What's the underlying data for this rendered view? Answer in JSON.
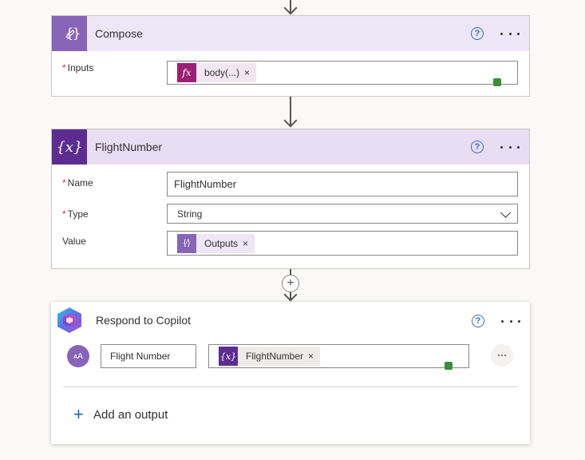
{
  "compose": {
    "title": "Compose",
    "inputs_label": "Inputs",
    "token_label": "body(...)",
    "token_icon": "fx-icon",
    "accent": "#8764b8"
  },
  "flight_number": {
    "title": "FlightNumber",
    "name_label": "Name",
    "name_value": "FlightNumber",
    "type_label": "Type",
    "type_value": "String",
    "value_label": "Value",
    "value_token": "Outputs",
    "accent": "#5c2d91"
  },
  "respond": {
    "title": "Respond to Copilot",
    "output_name": "Flight Number",
    "output_token": "FlightNumber",
    "add_output_label": "Add an output"
  },
  "common": {
    "help_glyph": "?",
    "remove_glyph": "×",
    "add_glyph": "+",
    "variable_glyph": "{x}",
    "compose_glyph": "{⁄}",
    "avatar_glyph": "ᴀA"
  }
}
